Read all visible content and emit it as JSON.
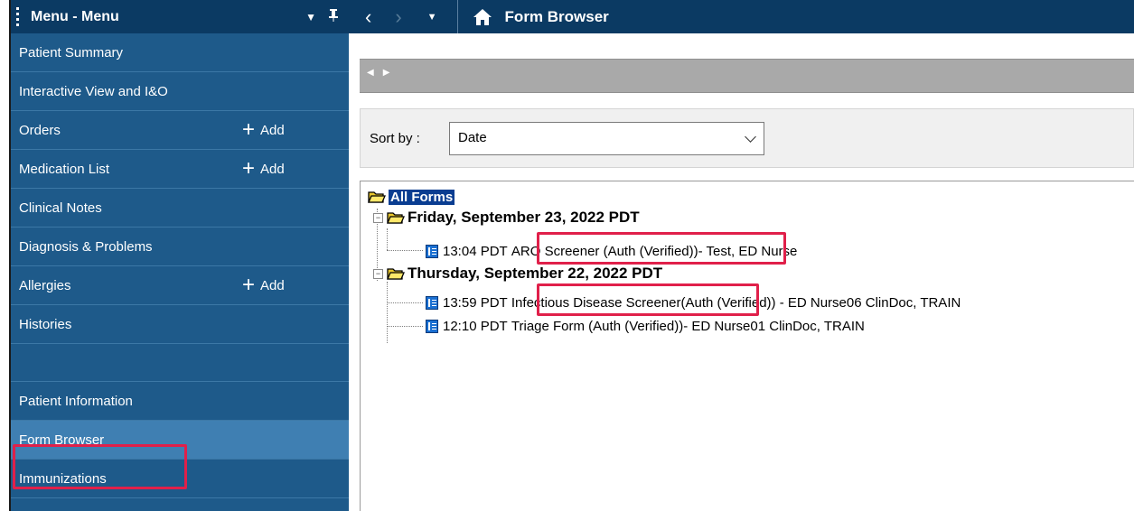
{
  "sidebar": {
    "title": "Menu - Menu",
    "items": [
      {
        "label": "Patient Summary"
      },
      {
        "label": "Interactive View and I&O"
      },
      {
        "label": "Orders",
        "add": "Add"
      },
      {
        "label": "Medication List",
        "add": "Add"
      },
      {
        "label": "Clinical Notes"
      },
      {
        "label": "Diagnosis & Problems"
      },
      {
        "label": "Allergies",
        "add": "Add"
      },
      {
        "label": "Histories"
      }
    ],
    "lower_items": [
      {
        "label": "Patient Information"
      },
      {
        "label": "Form Browser",
        "selected": true
      },
      {
        "label": "Immunizations"
      }
    ]
  },
  "header": {
    "title": "Form Browser"
  },
  "sort": {
    "label": "Sort by :",
    "value": "Date"
  },
  "tree": {
    "root": "All Forms",
    "groups": [
      {
        "date": "Friday, September 23, 2022 PDT",
        "forms": [
          {
            "time": "13:04 PDT",
            "name": "ARO Screener (Auth (Verified))",
            "rest": " - Test, ED Nurse"
          }
        ]
      },
      {
        "date": "Thursday, September 22, 2022 PDT",
        "forms": [
          {
            "time": "13:59 PDT",
            "name": "Infectious Disease Screener",
            "rest": " (Auth (Verified)) - ED Nurse06 ClinDoc, TRAIN"
          },
          {
            "time": "12:10 PDT",
            "name": "Triage Form (Auth (Verified))",
            "rest": " - ED Nurse01 ClinDoc, TRAIN"
          }
        ]
      }
    ]
  },
  "colors": {
    "sidebar_bg": "#1e5a8a",
    "header_bg": "#0b3a63",
    "highlight": "#e0204a",
    "root_selected": "#0a3d91"
  }
}
